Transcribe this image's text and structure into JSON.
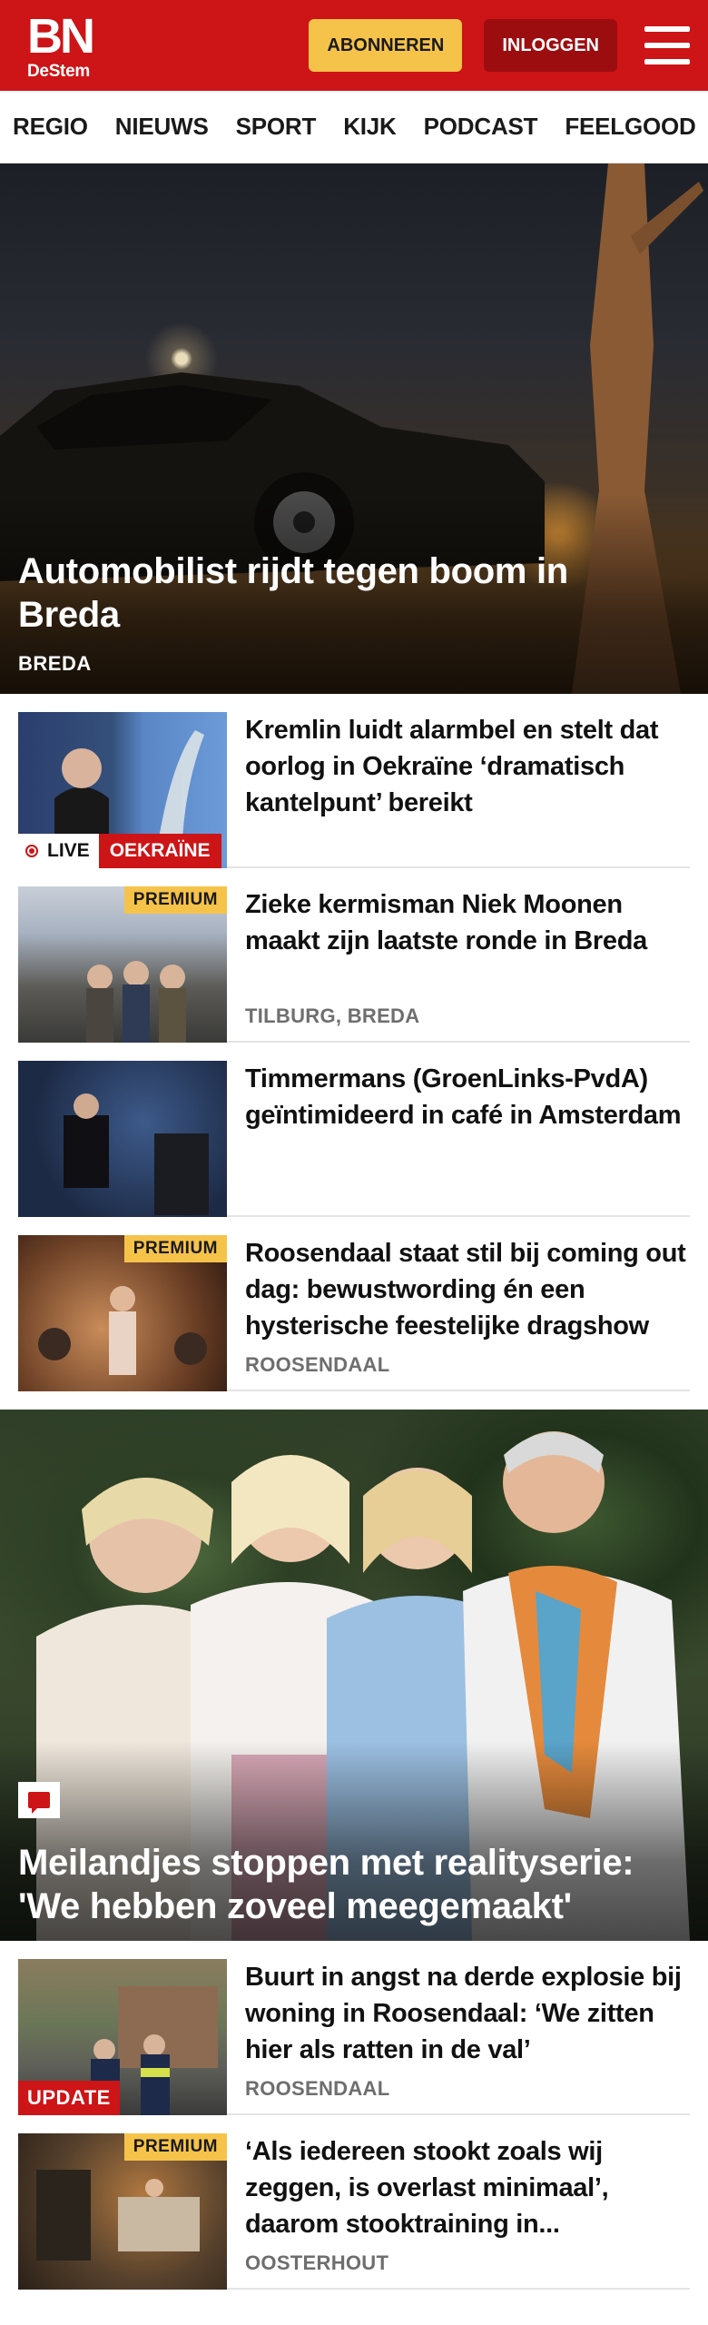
{
  "header": {
    "logo_main": "BN",
    "logo_sub": "DeStem",
    "subscribe_label": "ABONNEREN",
    "login_label": "INLOGGEN"
  },
  "nav": {
    "items": [
      "REGIO",
      "NIEUWS",
      "SPORT",
      "KIJK",
      "PODCAST",
      "FEELGOOD"
    ]
  },
  "hero_top": {
    "title": "Automobilist rijdt tegen boom in Breda",
    "tag": "BREDA"
  },
  "articles_a": [
    {
      "title": "Kremlin luidt alarmbel en stelt dat oorlog in Oekraïne ‘dramatisch kantelpunt’ bereikt",
      "live_label": "LIVE",
      "live_tag": "OEKRAÏNE"
    },
    {
      "title": "Zieke kermisman Niek Moonen maakt zijn laatste ronde in Breda",
      "badge": "PREMIUM",
      "tag": "TILBURG, BREDA"
    },
    {
      "title": "Timmermans (GroenLinks-PvdA) geïntimideerd in café in Amsterdam"
    },
    {
      "title": "Roosendaal staat stil bij coming out dag: bewustwording én een hysterische feestelijke dragshow",
      "badge": "PREMIUM",
      "tag": "ROOSENDAAL"
    }
  ],
  "hero_second": {
    "title": "Meilandjes stoppen met realityserie: 'We hebben zoveel meegemaakt'"
  },
  "articles_b": [
    {
      "title": "Buurt in angst na derde explosie bij woning in Roosendaal: ‘We zitten hier als ratten in de val’",
      "badge": "UPDATE",
      "tag": "ROOSENDAAL"
    },
    {
      "title": "‘Als iedereen stookt zoals wij zeggen, is overlast minimaal’, daarom stooktraining in...",
      "badge": "PREMIUM",
      "tag": "OOSTERHOUT"
    }
  ],
  "colors": {
    "brand_red": "#cd1417",
    "subscribe_yellow": "#f6c34a",
    "login_dark_red": "#9c0d10",
    "tag_grey": "#6e6e6e"
  }
}
